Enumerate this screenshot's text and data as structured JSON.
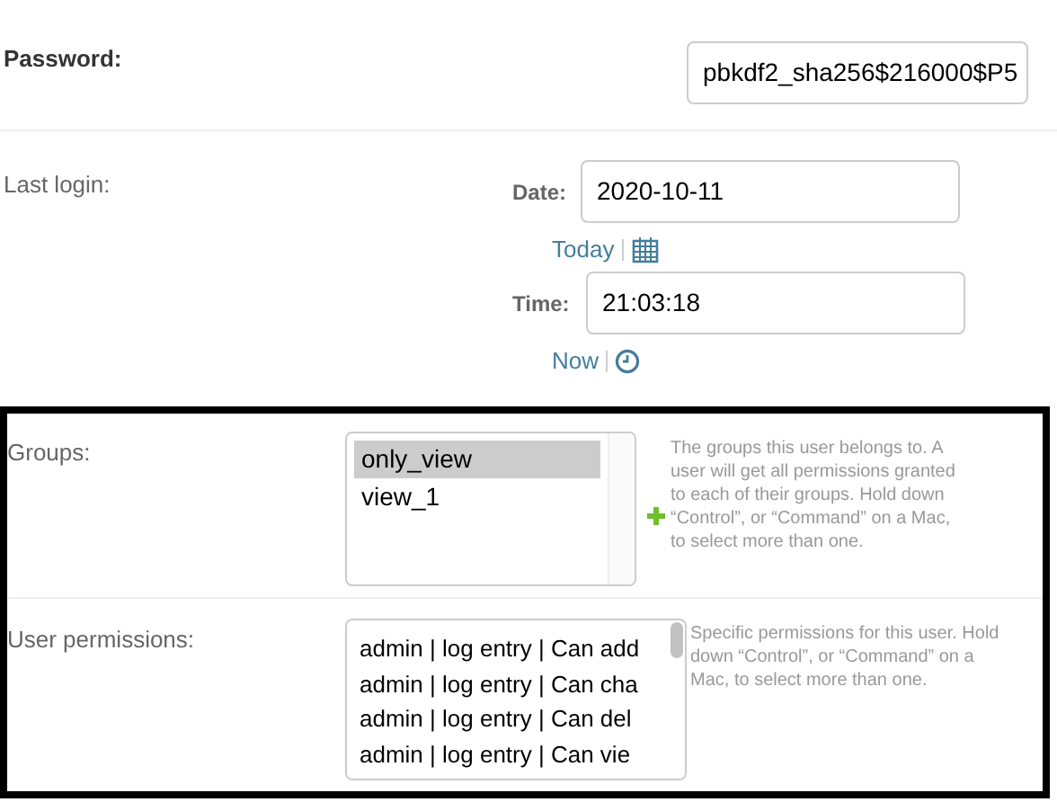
{
  "password": {
    "label": "Password:",
    "value": "pbkdf2_sha256$216000$P5"
  },
  "last_login": {
    "label": "Last login:",
    "date_label": "Date:",
    "date": "2020-10-11",
    "today_link": "Today",
    "time_label": "Time:",
    "time": "21:03:18",
    "now_link": "Now"
  },
  "groups": {
    "label": "Groups:",
    "options": [
      {
        "label": "only_view",
        "selected": true
      },
      {
        "label": "view_1",
        "selected": false
      }
    ],
    "help": "The groups this user belongs to. A user will get all permissions granted to each of their groups. Hold down “Control”, or “Command” on a Mac, to select more than one."
  },
  "user_permissions": {
    "label": "User permissions:",
    "options": [
      {
        "label": "admin | log entry | Can add",
        "selected": false
      },
      {
        "label": "admin | log entry | Can cha",
        "selected": false
      },
      {
        "label": "admin | log entry | Can del",
        "selected": false
      },
      {
        "label": "admin | log entry | Can vie",
        "selected": false
      }
    ],
    "help": "Specific permissions for this user. Hold down “Control”, or “Command” on a Mac, to select more than one."
  }
}
